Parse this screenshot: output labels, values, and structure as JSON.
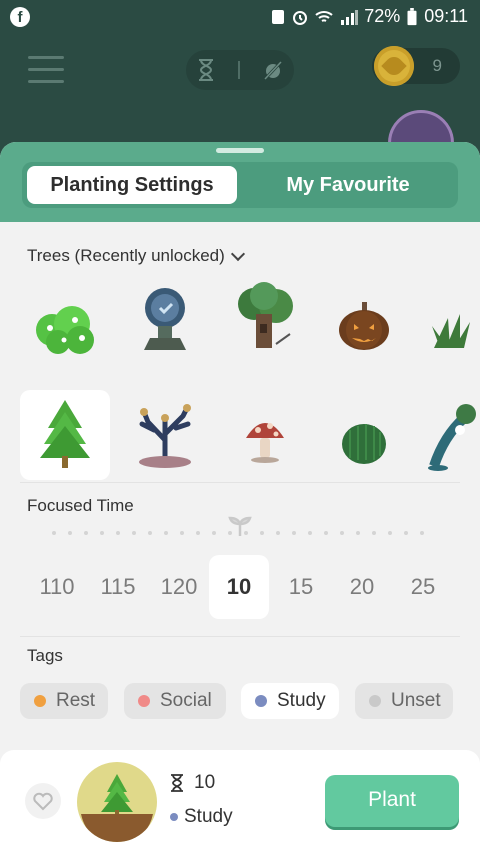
{
  "status_bar": {
    "battery": "72%",
    "time": "09:11",
    "app_icon": "facebook-icon"
  },
  "app_bar": {
    "coin_count": "9",
    "menu_icon": "hamburger-icon",
    "mode_icons": [
      "hourglass-icon",
      "timer-off-icon"
    ]
  },
  "sheet": {
    "tabs": [
      {
        "label": "Planting Settings",
        "active": true
      },
      {
        "label": "My Favourite",
        "active": false
      }
    ],
    "trees_label": "Trees (Recently unlocked)",
    "trees": [
      {
        "name": "Bush"
      },
      {
        "name": "Clock Tree"
      },
      {
        "name": "Treehouse"
      },
      {
        "name": "Pumpkin"
      },
      {
        "name": "Grass"
      },
      {
        "name": "Pine",
        "selected": true
      },
      {
        "name": "Coral"
      },
      {
        "name": "Mushroom"
      },
      {
        "name": "Cactus"
      },
      {
        "name": "Willow"
      }
    ],
    "focused_label": "Focused Time",
    "times": [
      "110",
      "115",
      "120",
      "10",
      "15",
      "20",
      "25"
    ],
    "selected_time": "10",
    "tags_label": "Tags",
    "tags": [
      {
        "label": "Rest",
        "color": "#f0a040"
      },
      {
        "label": "Social",
        "color": "#f08a88"
      },
      {
        "label": "Study",
        "color": "#7b8cc0",
        "selected": true
      },
      {
        "label": "Unset",
        "color": "#c9c9c9"
      }
    ]
  },
  "plant_bar": {
    "time": "10",
    "tag": "Study",
    "tag_color": "#7b8cc0",
    "plant_label": "Plant"
  }
}
